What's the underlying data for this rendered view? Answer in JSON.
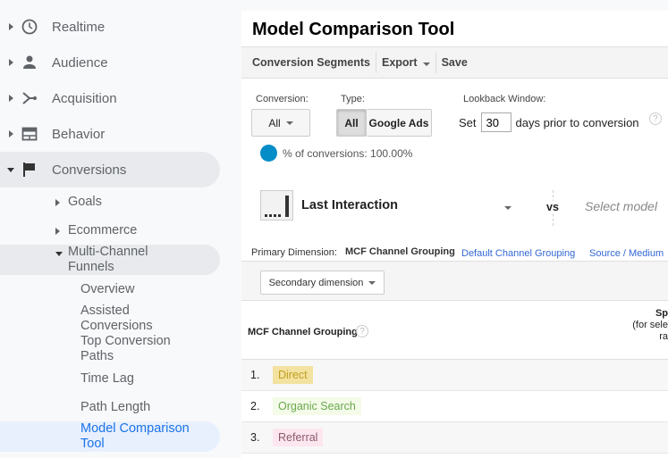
{
  "sidebar": {
    "items": [
      {
        "label": "Realtime",
        "icon": "clock-icon"
      },
      {
        "label": "Audience",
        "icon": "person-icon"
      },
      {
        "label": "Acquisition",
        "icon": "acquisition-icon"
      },
      {
        "label": "Behavior",
        "icon": "behavior-icon"
      },
      {
        "label": "Conversions",
        "icon": "flag-icon"
      }
    ],
    "conversions_children": [
      "Goals",
      "Ecommerce",
      "Multi-Channel Funnels"
    ],
    "mcf_children": [
      "Overview",
      "Assisted Conversions",
      "Top Conversion Paths",
      "Time Lag",
      "Path Length",
      "Model Comparison Tool"
    ]
  },
  "main": {
    "title": "Model Comparison Tool",
    "toolbar": {
      "segments": "Conversion Segments",
      "export": "Export",
      "save": "Save"
    },
    "conversion": {
      "label": "Conversion:",
      "value": "All"
    },
    "type": {
      "label": "Type:",
      "options": [
        "All",
        "Google Ads"
      ],
      "selected": "All"
    },
    "lookback": {
      "label": "Lookback Window:",
      "prefix": "Set",
      "value": "30",
      "suffix": "days prior to conversion"
    },
    "percent": "% of conversions: 100.00%",
    "accent": "#058dc7",
    "model": {
      "name": "Last Interaction",
      "vs": "vs",
      "select_placeholder": "Select model"
    },
    "primary_dimension": {
      "label": "Primary Dimension:",
      "options": [
        "MCF Channel Grouping",
        "Default Channel Grouping",
        "Source / Medium"
      ],
      "selected": "MCF Channel Grouping"
    },
    "secondary_dimension": "Secondary dimension",
    "table": {
      "header": "MCF Channel Grouping",
      "right_header": [
        "Sp",
        "(for sele",
        "ra"
      ],
      "rows": [
        {
          "n": "1.",
          "label": "Direct",
          "bg": "#f3e2a0",
          "fg": "#c0a020"
        },
        {
          "n": "2.",
          "label": "Organic Search",
          "bg": "#f4fbe9",
          "fg": "#6aa84f"
        },
        {
          "n": "3.",
          "label": "Referral",
          "bg": "#fde6ef",
          "fg": "#8a5a6a"
        }
      ]
    }
  }
}
